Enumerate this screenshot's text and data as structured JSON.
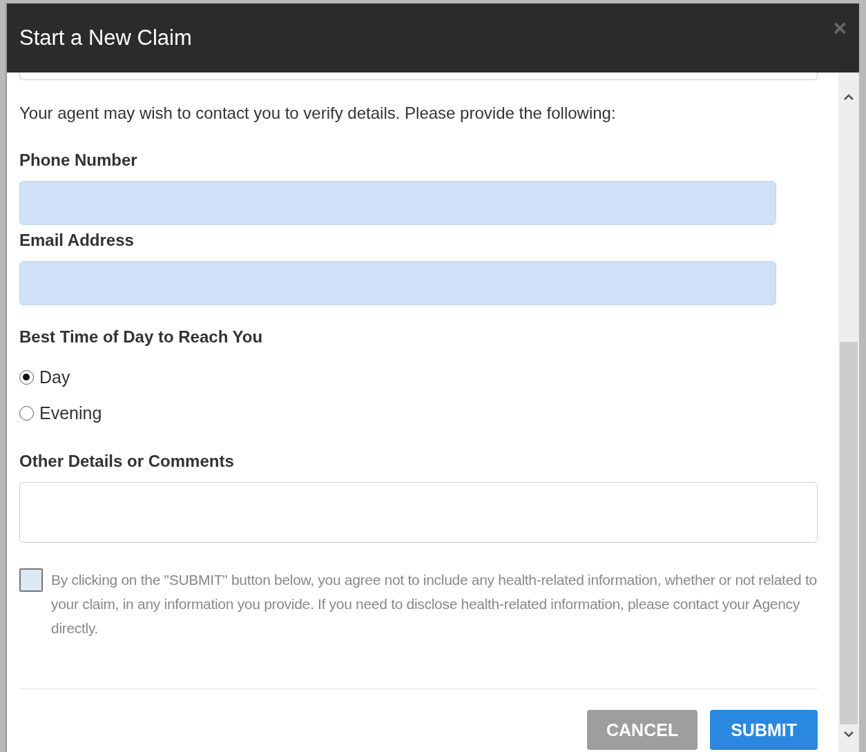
{
  "dialog": {
    "title": "Start a New Claim",
    "close": "×"
  },
  "intro": "Your agent may wish to contact you to verify details. Please provide the following:",
  "fields": [
    {
      "label": "Phone Number",
      "kind": "filled"
    },
    {
      "label": "Email Address",
      "kind": "filled"
    }
  ],
  "time_of_day": {
    "label": "Best Time of Day to Reach You",
    "options": [
      {
        "label": "Day",
        "selected": true
      },
      {
        "label": "Evening",
        "selected": false
      }
    ]
  },
  "comments": {
    "label": "Other Details or Comments"
  },
  "agreement": {
    "checked": false,
    "text": "By clicking on the \"SUBMIT\" button below, you agree not to include any health-related information, whether or not related to your claim, in any information you provide. If you need to disclose health-related information, please contact your Agency directly."
  },
  "buttons": [
    {
      "label": "CANCEL",
      "kind": "secondary"
    },
    {
      "label": "SUBMIT",
      "kind": "primary"
    }
  ]
}
